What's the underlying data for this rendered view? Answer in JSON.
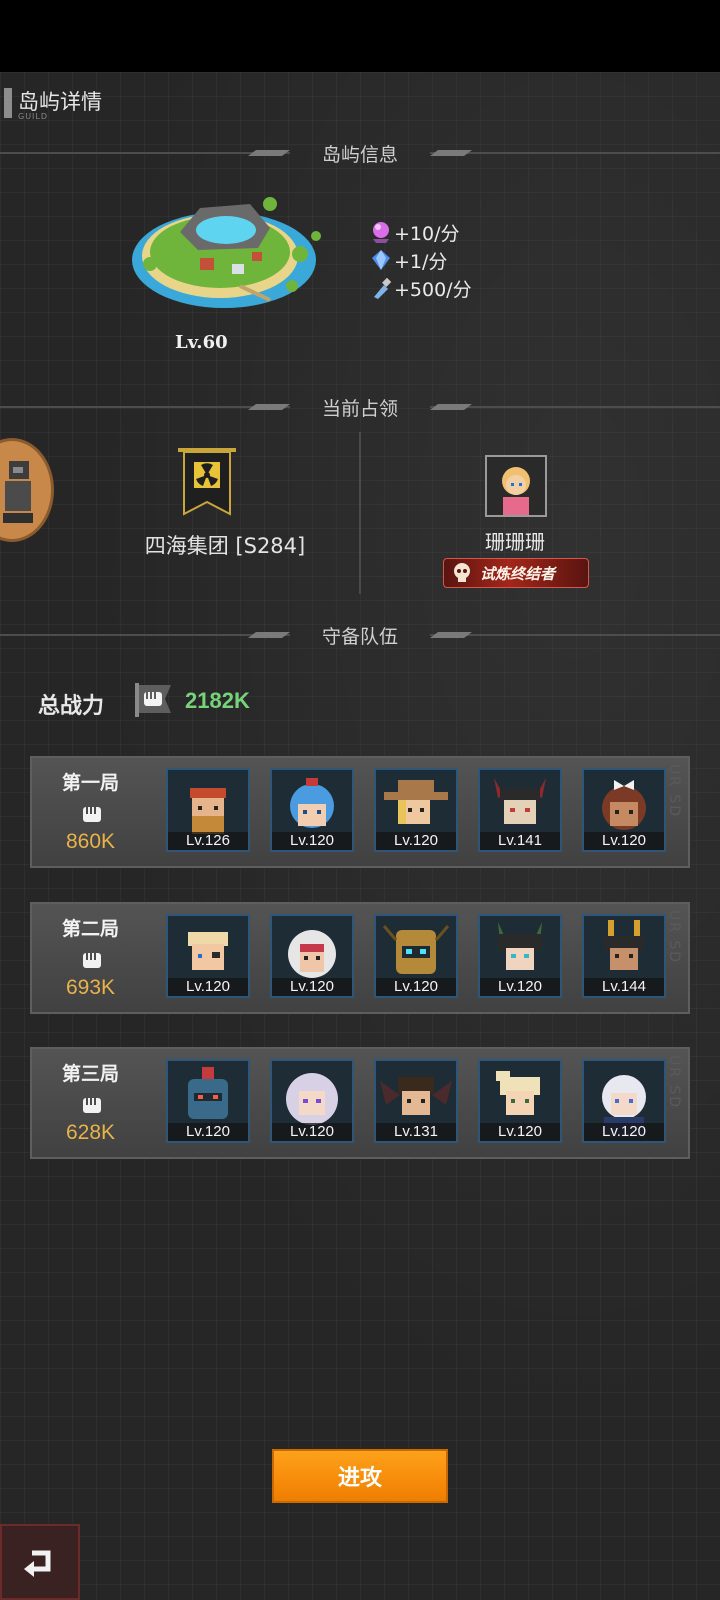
{
  "header": {
    "title": "岛屿详情",
    "subtitle": "GUILD"
  },
  "sections": {
    "island_info": "岛屿信息",
    "current_occupation": "当前占领",
    "defense_team": "守备队伍"
  },
  "island": {
    "level": "Lv.60",
    "rewards": [
      {
        "icon": "pink-orb-icon",
        "text": "+10/分"
      },
      {
        "icon": "blue-gem-icon",
        "text": "+1/分"
      },
      {
        "icon": "bottle-icon",
        "text": "+500/分"
      }
    ]
  },
  "occupation": {
    "guild_name": "四海集团 [S284]",
    "leader_name": "珊珊珊",
    "leader_title": "试炼终结者"
  },
  "power": {
    "label": "总战力",
    "value": "2182K"
  },
  "teams": [
    {
      "round": "第一局",
      "power": "860K",
      "heroes": [
        {
          "level": "Lv.126",
          "icon": "hero-bandana-icon"
        },
        {
          "level": "Lv.120",
          "icon": "hero-blue-hair-icon"
        },
        {
          "level": "Lv.120",
          "icon": "hero-cowboy-icon"
        },
        {
          "level": "Lv.141",
          "icon": "hero-horned-icon"
        },
        {
          "level": "Lv.120",
          "icon": "hero-bow-girl-icon"
        }
      ]
    },
    {
      "round": "第二局",
      "power": "693K",
      "heroes": [
        {
          "level": "Lv.120",
          "icon": "hero-eyepatch-icon"
        },
        {
          "level": "Lv.120",
          "icon": "hero-hooded-icon"
        },
        {
          "level": "Lv.120",
          "icon": "hero-robot-icon"
        },
        {
          "level": "Lv.120",
          "icon": "hero-dark-horned-icon"
        },
        {
          "level": "Lv.144",
          "icon": "hero-bunny-icon"
        }
      ]
    },
    {
      "round": "第三局",
      "power": "628K",
      "heroes": [
        {
          "level": "Lv.120",
          "icon": "hero-helmet-icon"
        },
        {
          "level": "Lv.120",
          "icon": "hero-silver-hair-icon"
        },
        {
          "level": "Lv.131",
          "icon": "hero-winged-icon"
        },
        {
          "level": "Lv.120",
          "icon": "hero-blonde-icon"
        },
        {
          "level": "Lv.120",
          "icon": "hero-white-hair-icon"
        }
      ]
    }
  ],
  "buttons": {
    "attack": "进攻"
  },
  "colors": {
    "power_green": "#76d37a",
    "round_power_gold": "#e8b34a",
    "attack_orange": "#f7900a"
  }
}
